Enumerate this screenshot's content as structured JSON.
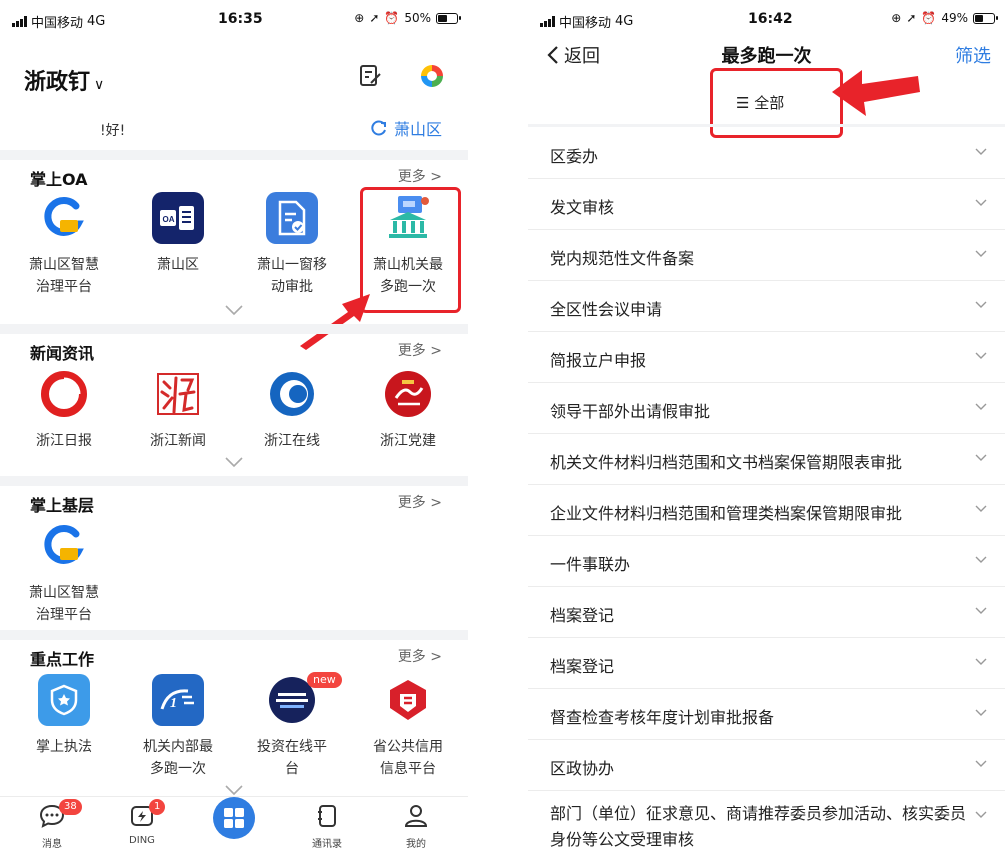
{
  "left": {
    "status": {
      "carrier": "中国移动",
      "network": "4G",
      "time": "16:35",
      "battery": "50%",
      "battery_level": 0.5
    },
    "header": {
      "title": "浙政钉",
      "greeting": "!好!",
      "region": "萧山区"
    },
    "sections": [
      {
        "title": "掌上OA",
        "more": "更多 >",
        "apps": [
          {
            "label": "萧山区智慧治理平台",
            "icon": "smart-governance-icon"
          },
          {
            "label": "萧山区",
            "icon": "oa-icon"
          },
          {
            "label": "萧山一窗移动审批",
            "icon": "window-approval-icon"
          },
          {
            "label": "萧山机关最多跑一次",
            "icon": "run-once-icon"
          }
        ]
      },
      {
        "title": "新闻资讯",
        "more": "更多 >",
        "apps": [
          {
            "label": "浙江日报",
            "icon": "zhejiang-daily-icon"
          },
          {
            "label": "浙江新闻",
            "icon": "zhejiang-news-icon"
          },
          {
            "label": "浙江在线",
            "icon": "zhejiang-online-icon"
          },
          {
            "label": "浙江党建",
            "icon": "party-building-icon"
          }
        ]
      },
      {
        "title": "掌上基层",
        "more": "更多 >",
        "apps": [
          {
            "label": "萧山区智慧治理平台",
            "icon": "smart-governance-icon"
          }
        ]
      },
      {
        "title": "重点工作",
        "more": "更多 >",
        "apps": [
          {
            "label": "掌上执法",
            "icon": "law-enforcement-icon"
          },
          {
            "label": "机关内部最多跑一次",
            "icon": "internal-run-once-icon"
          },
          {
            "label": "投资在线平台",
            "icon": "investment-online-icon",
            "badge": "new"
          },
          {
            "label": "省公共信用信息平台",
            "icon": "public-credit-icon"
          }
        ]
      }
    ],
    "tabbar": [
      {
        "label": "消息",
        "badge": "38",
        "icon": "message-icon"
      },
      {
        "label": "DING",
        "badge": "1",
        "icon": "ding-icon"
      },
      {
        "label": "",
        "icon": "workbench-icon"
      },
      {
        "label": "通讯录",
        "icon": "contacts-icon"
      },
      {
        "label": "我的",
        "icon": "profile-icon"
      }
    ]
  },
  "right": {
    "status": {
      "carrier": "中国移动",
      "network": "4G",
      "time": "16:42",
      "battery": "49%",
      "battery_level": 0.49
    },
    "nav": {
      "back": "返回",
      "title": "最多跑一次",
      "filter": "筛选"
    },
    "filter_all": "☰ 全部",
    "items": [
      "区委办",
      "发文审核",
      "党内规范性文件备案",
      "全区性会议申请",
      "简报立户申报",
      "领导干部外出请假审批",
      "机关文件材料归档范围和文书档案保管期限表审批",
      "企业文件材料归档范围和管理类档案保管期限审批",
      "一件事联办",
      "档案登记",
      "档案登记",
      "督查检查考核年度计划审批报备",
      "区政协办",
      "部门（单位）征求意见、商请推荐委员参加活动、核实委员身份等公文受理审核"
    ]
  },
  "colors": {
    "accent": "#2f7de1",
    "highlight": "#e8232a",
    "badge": "#f3453f",
    "separator": "#f2f3f5"
  }
}
